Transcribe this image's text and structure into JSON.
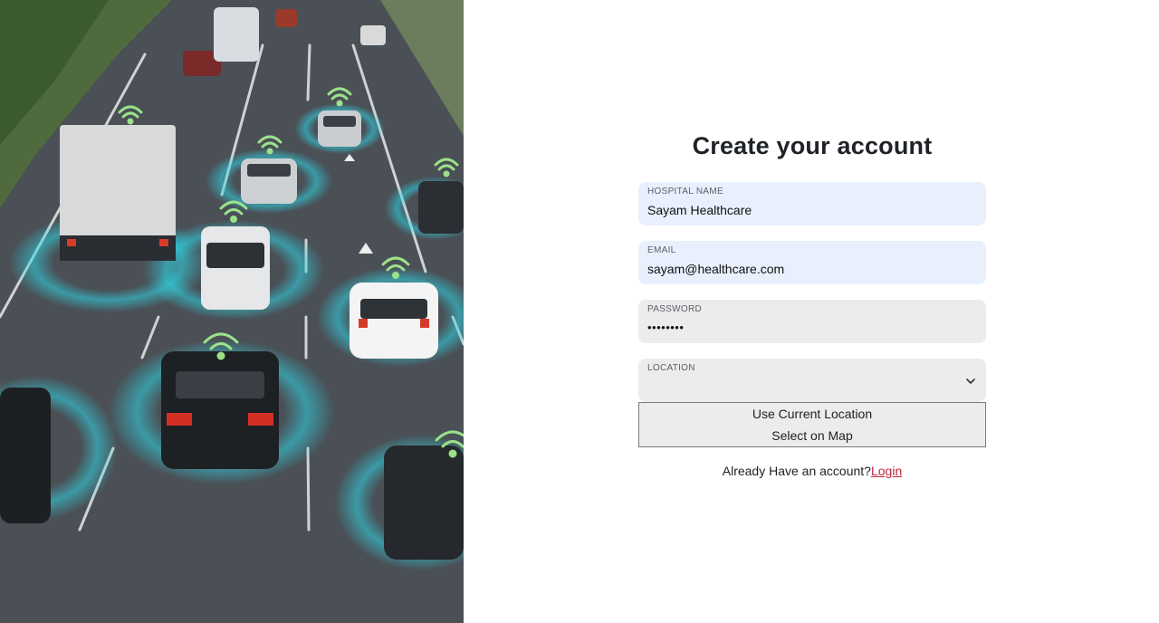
{
  "form": {
    "title": "Create your account",
    "hospital_name": {
      "label": "HOSPITAL NAME",
      "value": "Sayam Healthcare"
    },
    "email": {
      "label": "EMAIL",
      "value": "sayam@healthcare.com"
    },
    "password": {
      "label": "PASSWORD",
      "value": "••••••••"
    },
    "location": {
      "label": "LOCATION",
      "value": "",
      "options": [
        "Use Current Location",
        "Select on Map"
      ]
    }
  },
  "footer": {
    "prompt": "Already Have an account?",
    "login_label": "Login"
  },
  "colors": {
    "autofill_bg": "#e8f0fe",
    "field_bg": "#ececec",
    "link": "#c0233f",
    "sensor_ring": "#2fd6e6",
    "wifi_signal": "#9be28a"
  }
}
